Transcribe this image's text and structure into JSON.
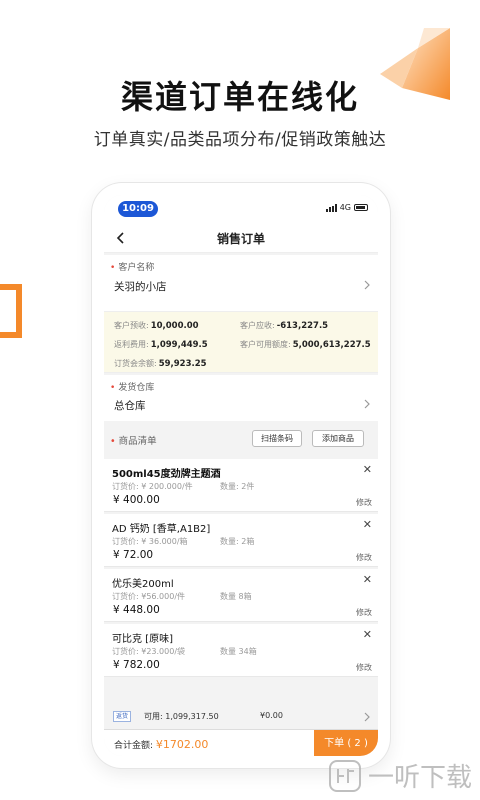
{
  "headline": "渠道订单在线化",
  "subline": "订单真实/品类品项分布/促销政策触达",
  "phone": {
    "status_time": "10:09",
    "network": "4G",
    "nav_title": "销售订单",
    "customer_label": "客户名称",
    "customer_value": "关羽的小店",
    "info": {
      "prepaid_label": "客户预收:",
      "prepaid_value": "10,000.00",
      "receivable_label": "客户应收:",
      "receivable_value": "-613,227.5",
      "rebate_label": "返利费用:",
      "rebate_value": "1,099,449.5",
      "available_label": "客户可用额度:",
      "available_value": "5,000,613,227.5",
      "meeting_label": "订货会余额:",
      "meeting_value": "59,923.25"
    },
    "warehouse_label": "发货仓库",
    "warehouse_value": "总仓库",
    "list_label": "商品清单",
    "scan_button": "扫描条码",
    "add_button": "添加商品",
    "items": [
      {
        "name": "500ml45度劲牌主题酒",
        "unit_price": "订货价:  ¥ 200.000/件",
        "qty": "数量:  2件",
        "total": "¥ 400.00",
        "edit": "修改"
      },
      {
        "name": "AD 钙奶 [香草,A1B2]",
        "unit_price": "订货价:  ¥ 36.000/箱",
        "qty": "数量:  2箱",
        "total": "¥ 72.00",
        "edit": "修改"
      },
      {
        "name": "优乐美200ml",
        "unit_price": "订货价:  ¥56.000/件",
        "qty": "数量  8箱",
        "total": "¥ 448.00",
        "edit": "修改"
      },
      {
        "name": "可比克 [原味]",
        "unit_price": "订货价:  ¥23.000/袋",
        "qty": "数量  34箱",
        "total": "¥ 782.00",
        "edit": "修改"
      }
    ],
    "rebate_tag": "返货",
    "available_text": "可用:  1,099,317.50",
    "rebate_used": "¥0.00",
    "total_label": "合计金额:",
    "total_value": "¥1702.00",
    "order_button": "下单  ( 2 )"
  },
  "watermark": "一听下载",
  "colors": {
    "accent": "#f4892a",
    "status_pill": "#1c57d6",
    "info_bg": "#fbf9e8",
    "required": "#e5493b"
  }
}
